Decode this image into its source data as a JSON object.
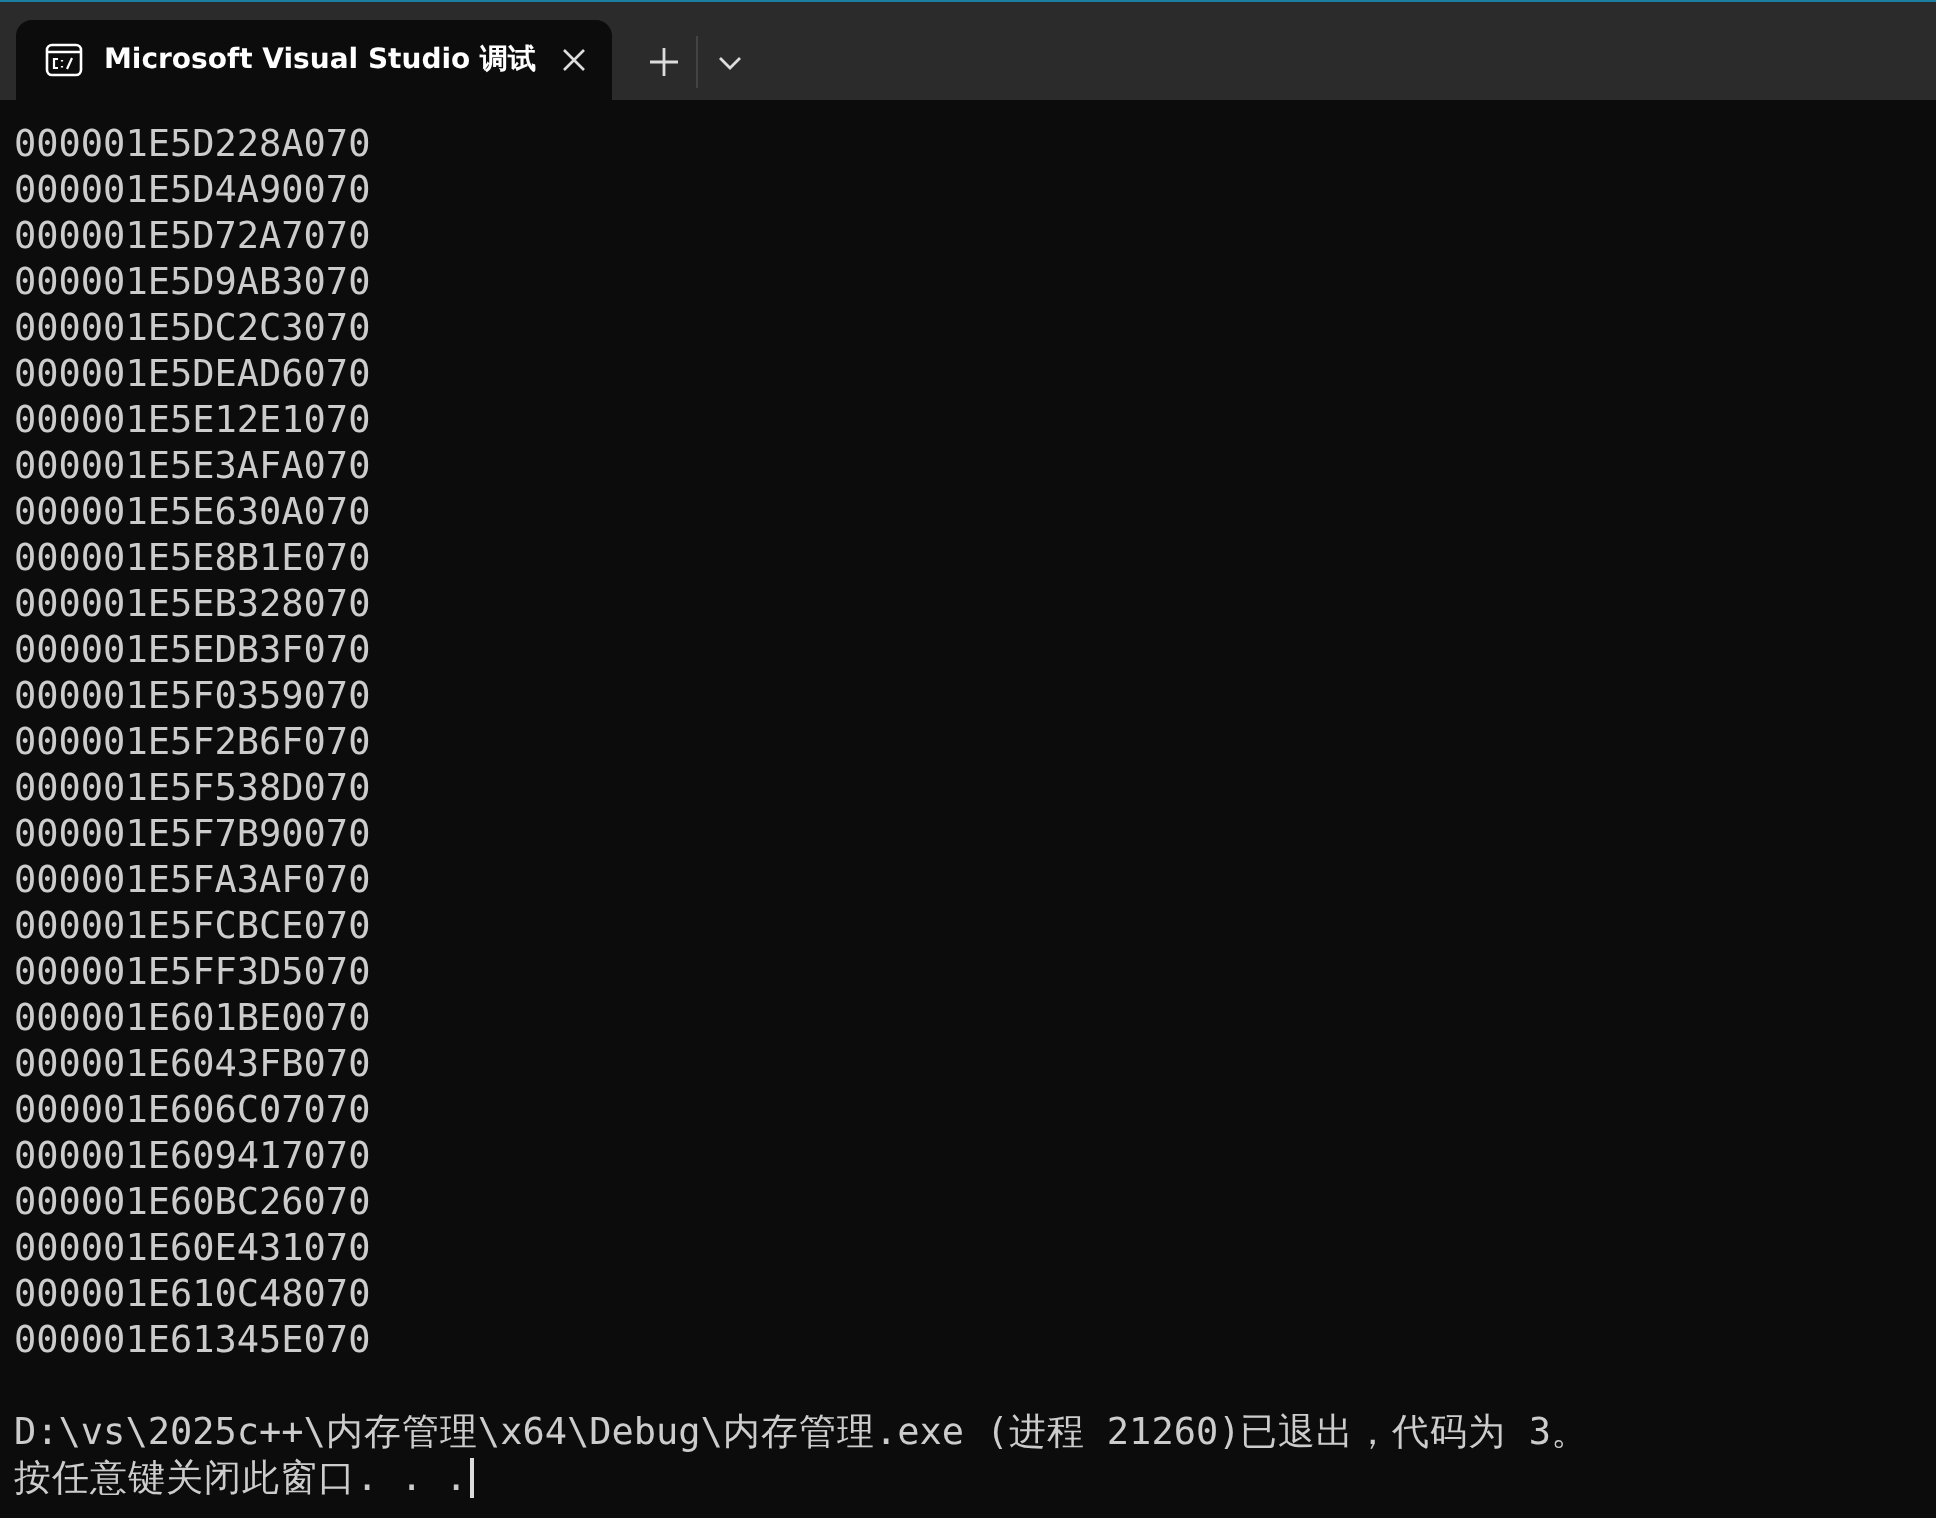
{
  "tabs": [
    {
      "title": "Microsoft Visual Studio 调试",
      "selected": true
    }
  ],
  "console": {
    "lines": [
      "000001E5D228A070",
      "000001E5D4A90070",
      "000001E5D72A7070",
      "000001E5D9AB3070",
      "000001E5DC2C3070",
      "000001E5DEAD6070",
      "000001E5E12E1070",
      "000001E5E3AFA070",
      "000001E5E630A070",
      "000001E5E8B1E070",
      "000001E5EB328070",
      "000001E5EDB3F070",
      "000001E5F0359070",
      "000001E5F2B6F070",
      "000001E5F538D070",
      "000001E5F7B90070",
      "000001E5FA3AF070",
      "000001E5FCBCE070",
      "000001E5FF3D5070",
      "000001E601BE0070",
      "000001E6043FB070",
      "000001E606C07070",
      "000001E609417070",
      "000001E60BC26070",
      "000001E60E431070",
      "000001E610C48070",
      "000001E61345E070",
      "D:\\vs\\2025c++\\内存管理\\x64\\Debug\\内存管理.exe (进程 21260)已退出，代码为 3。",
      "按任意键关闭此窗口. . ."
    ]
  }
}
